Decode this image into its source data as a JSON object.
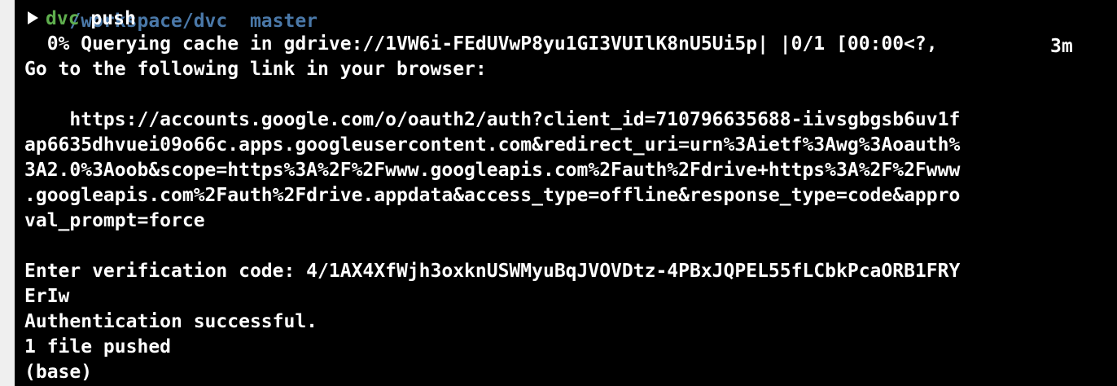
{
  "window": {
    "cut_off_top_left": "/workspace/dvc  master",
    "cut_off_top_right": "3m"
  },
  "command": {
    "program": "dvc",
    "argument": "push"
  },
  "output": {
    "progress_line": "  0% Querying cache in gdrive://1VW6i-FEdUVwP8yu1GI3VUIlK8nU5Ui5p| |0/1 [00:00<?,",
    "link_prompt": "Go to the following link in your browser:",
    "url_lines": [
      "    https://accounts.google.com/o/oauth2/auth?client_id=710796635688-iivsgbgsb6uv1f",
      "ap6635dhvuei09o66c.apps.googleusercontent.com&redirect_uri=urn%3Aietf%3Awg%3Aoauth%",
      "3A2.0%3Aoob&scope=https%3A%2F%2Fwww.googleapis.com%2Fauth%2Fdrive+https%3A%2F%2Fwww",
      ".googleapis.com%2Fauth%2Fdrive.appdata&access_type=offline&response_type=code&appro",
      "val_prompt=force"
    ],
    "verification_lines": [
      "Enter verification code: 4/1AX4XfWjh3oxknUSWMyuBqJVOVDtz-4PBxJQPEL55fLCbkPcaORB1FRY",
      "ErIw"
    ],
    "auth_result": "Authentication successful.",
    "push_result": "1 file pushed",
    "next_prompt": "(base)"
  },
  "colors": {
    "background": "#000000",
    "text": "#ffffff",
    "command_green": "#5fae4e",
    "path_blue": "#4a78a8"
  }
}
